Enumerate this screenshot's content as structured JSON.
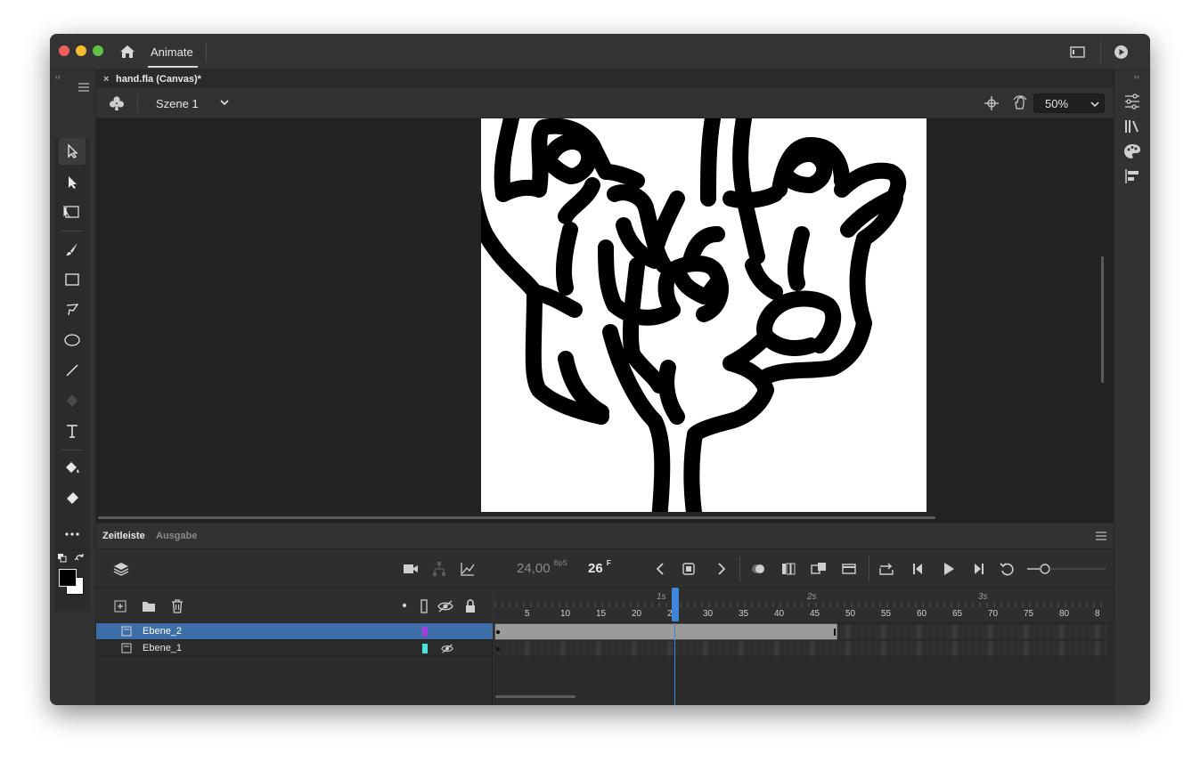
{
  "app": {
    "name": "Animate",
    "colors": {
      "window_bg": "#323232",
      "stage_bg": "#232323",
      "canvas": "#ffffff",
      "selection": "#3d6ea8",
      "playhead": "#3d86d8"
    }
  },
  "document": {
    "tab_title": "hand.fla (Canvas)*",
    "tab_close": "×"
  },
  "editbar": {
    "scene": "Szene 1",
    "zoom": "50%"
  },
  "timeline": {
    "tabs": [
      "Zeitleiste",
      "Ausgabe"
    ],
    "fps": "24,00",
    "fps_unit": "BpS",
    "current_frame": "26",
    "frame_unit": "F",
    "ruler_numbers": [
      "5",
      "10",
      "15",
      "20",
      "25",
      "30",
      "35",
      "40",
      "45",
      "50",
      "55",
      "60",
      "65",
      "70",
      "75",
      "80",
      "8"
    ],
    "ruler_seconds": [
      "1s",
      "2s",
      "3s"
    ],
    "layers": [
      {
        "name": "Ebene_2",
        "color": "#a23de0",
        "selected": true,
        "hidden": false
      },
      {
        "name": "Ebene_1",
        "color": "#4fe0e0",
        "selected": false,
        "hidden": true
      }
    ]
  }
}
